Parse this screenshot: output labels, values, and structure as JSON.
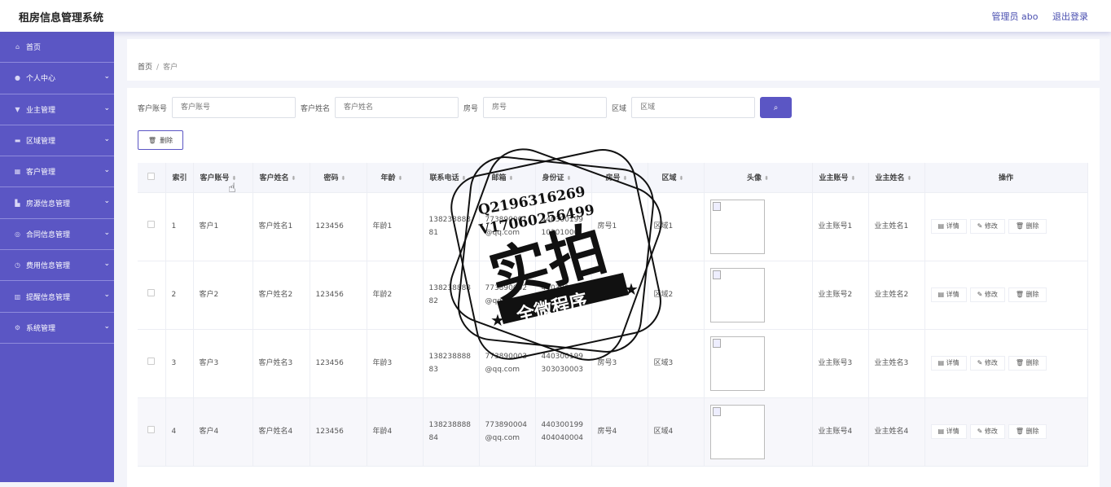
{
  "app": {
    "title": "租房信息管理系统",
    "user": "管理员 abo",
    "logout": "退出登录"
  },
  "sidebar": {
    "items": [
      {
        "label": "首页",
        "icon": "home-icon",
        "expand": false
      },
      {
        "label": "个人中心",
        "icon": "user-icon",
        "expand": true
      },
      {
        "label": "业主管理",
        "icon": "owner-icon",
        "expand": true
      },
      {
        "label": "区域管理",
        "icon": "chat-icon",
        "expand": true
      },
      {
        "label": "客户管理",
        "icon": "grid-icon",
        "expand": true
      },
      {
        "label": "房源信息管理",
        "icon": "building-icon",
        "expand": true
      },
      {
        "label": "合同信息管理",
        "icon": "compass-icon",
        "expand": true
      },
      {
        "label": "费用信息管理",
        "icon": "clock-icon",
        "expand": true
      },
      {
        "label": "提醒信息管理",
        "icon": "chart-icon",
        "expand": true
      },
      {
        "label": "系统管理",
        "icon": "settings-icon",
        "expand": true
      }
    ]
  },
  "breadcrumb": {
    "home": "首页",
    "sep": "/",
    "current": "客户"
  },
  "search": {
    "account_label": "客户账号",
    "account_placeholder": "客户账号",
    "name_label": "客户姓名",
    "name_placeholder": "客户姓名",
    "room_label": "房号",
    "room_placeholder": "房号",
    "area_label": "区域",
    "area_placeholder": "区域"
  },
  "toolbar": {
    "delete_label": "删除"
  },
  "table": {
    "headers": [
      "索引",
      "客户账号",
      "客户姓名",
      "密码",
      "年龄",
      "联系电话",
      "邮箱",
      "身份证",
      "房号",
      "区域",
      "头像",
      "业主账号",
      "业主姓名",
      "操作"
    ],
    "rows": [
      {
        "idx": "1",
        "account": "客户1",
        "name": "客户姓名1",
        "pwd": "123456",
        "age": "年龄1",
        "phone1": "138238888",
        "phone2": "81",
        "email1": "773890001",
        "email2": "@qq.com",
        "id1": "440300199",
        "id2": "101010001",
        "room": "房号1",
        "area": "区域1",
        "oacc": "业主账号1",
        "oname": "业主姓名1"
      },
      {
        "idx": "2",
        "account": "客户2",
        "name": "客户姓名2",
        "pwd": "123456",
        "age": "年龄2",
        "phone1": "138238888",
        "phone2": "82",
        "email1": "773890002",
        "email2": "@qq.com",
        "id1": "440300199",
        "id2": "202020002",
        "room": "房号2",
        "area": "区域2",
        "oacc": "业主账号2",
        "oname": "业主姓名2"
      },
      {
        "idx": "3",
        "account": "客户3",
        "name": "客户姓名3",
        "pwd": "123456",
        "age": "年龄3",
        "phone1": "138238888",
        "phone2": "83",
        "email1": "773890003",
        "email2": "@qq.com",
        "id1": "440300199",
        "id2": "303030003",
        "room": "房号3",
        "area": "区域3",
        "oacc": "业主账号3",
        "oname": "业主姓名3"
      },
      {
        "idx": "4",
        "account": "客户4",
        "name": "客户姓名4",
        "pwd": "123456",
        "age": "年龄4",
        "phone1": "138238888",
        "phone2": "84",
        "email1": "773890004",
        "email2": "@qq.com",
        "id1": "440300199",
        "id2": "404040004",
        "room": "房号4",
        "area": "区域4",
        "oacc": "业主账号4",
        "oname": "业主姓名4"
      }
    ],
    "actions": {
      "detail": "详情",
      "edit": "修改",
      "delete": "删除"
    }
  },
  "watermark": {
    "line1": "Q2196316269",
    "line2": "V17060256499",
    "big": "实拍",
    "banner": "全微程序"
  },
  "colors": {
    "accent": "#5b56c4"
  }
}
